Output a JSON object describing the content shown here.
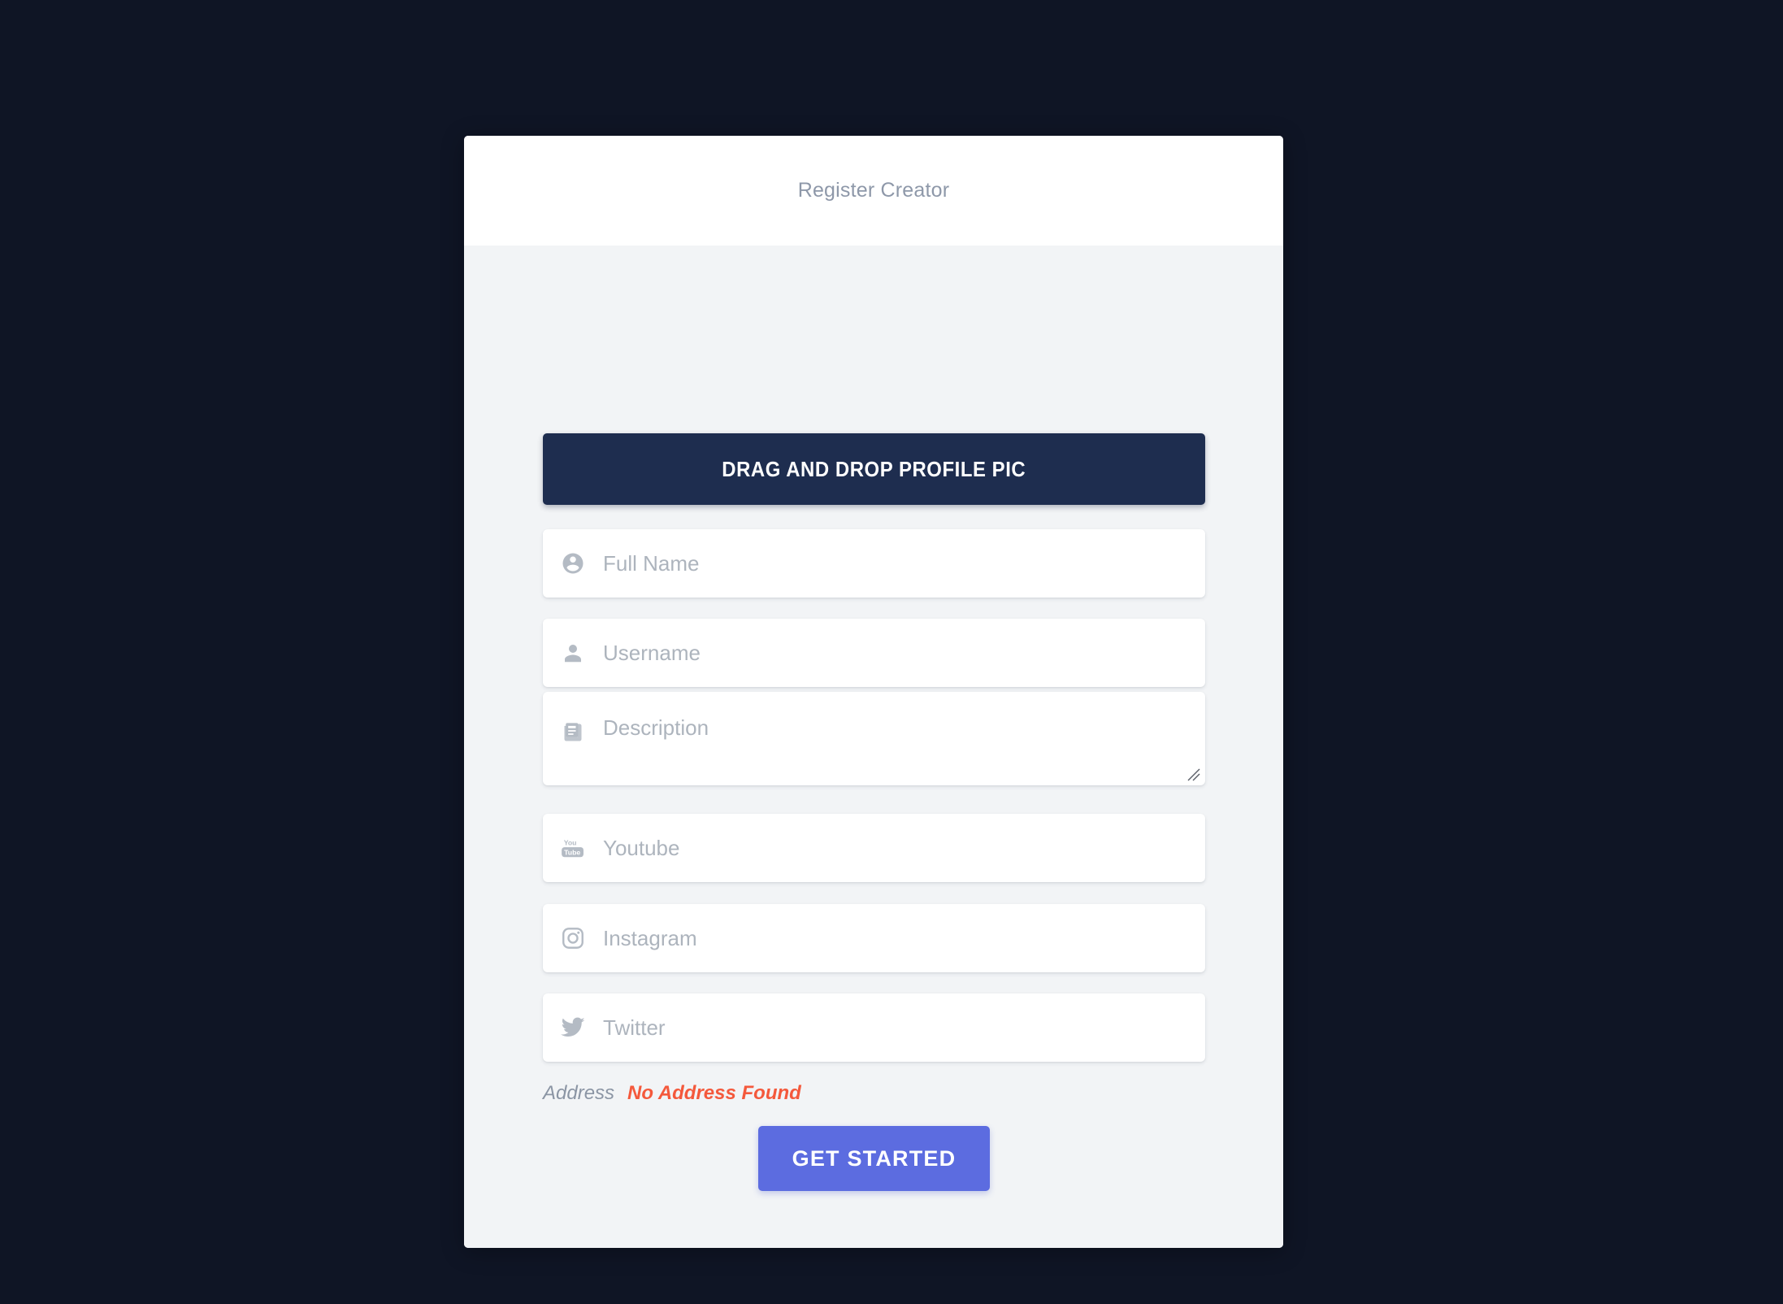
{
  "page": {
    "background_color": "#0f1525"
  },
  "card": {
    "header": {
      "title": "Register Creator"
    },
    "dropzone": {
      "label": "DRAG AND DROP PROFILE PIC",
      "icon": "upload-dropzone",
      "background_color": "#1e2d4f",
      "text_color": "#ffffff"
    },
    "fields": [
      {
        "name": "full-name",
        "icon": "account-circle-icon",
        "placeholder": "Full Name",
        "value": "",
        "type": "text"
      },
      {
        "name": "username",
        "icon": "person-icon",
        "placeholder": "Username",
        "value": "",
        "type": "text"
      },
      {
        "name": "description",
        "icon": "article-icon",
        "placeholder": "Description",
        "value": "",
        "type": "textarea"
      },
      {
        "name": "youtube",
        "icon": "youtube-icon",
        "placeholder": "Youtube",
        "value": "",
        "type": "text"
      },
      {
        "name": "instagram",
        "icon": "instagram-icon",
        "placeholder": "Instagram",
        "value": "",
        "type": "text"
      },
      {
        "name": "twitter",
        "icon": "twitter-icon",
        "placeholder": "Twitter",
        "value": "",
        "type": "text"
      }
    ],
    "address": {
      "label": "Address",
      "value": "No Address Found",
      "value_color": "#f4593c",
      "label_color": "#8b95a4"
    },
    "cta": {
      "label": "GET STARTED",
      "background_color": "#5c6ce0"
    }
  }
}
